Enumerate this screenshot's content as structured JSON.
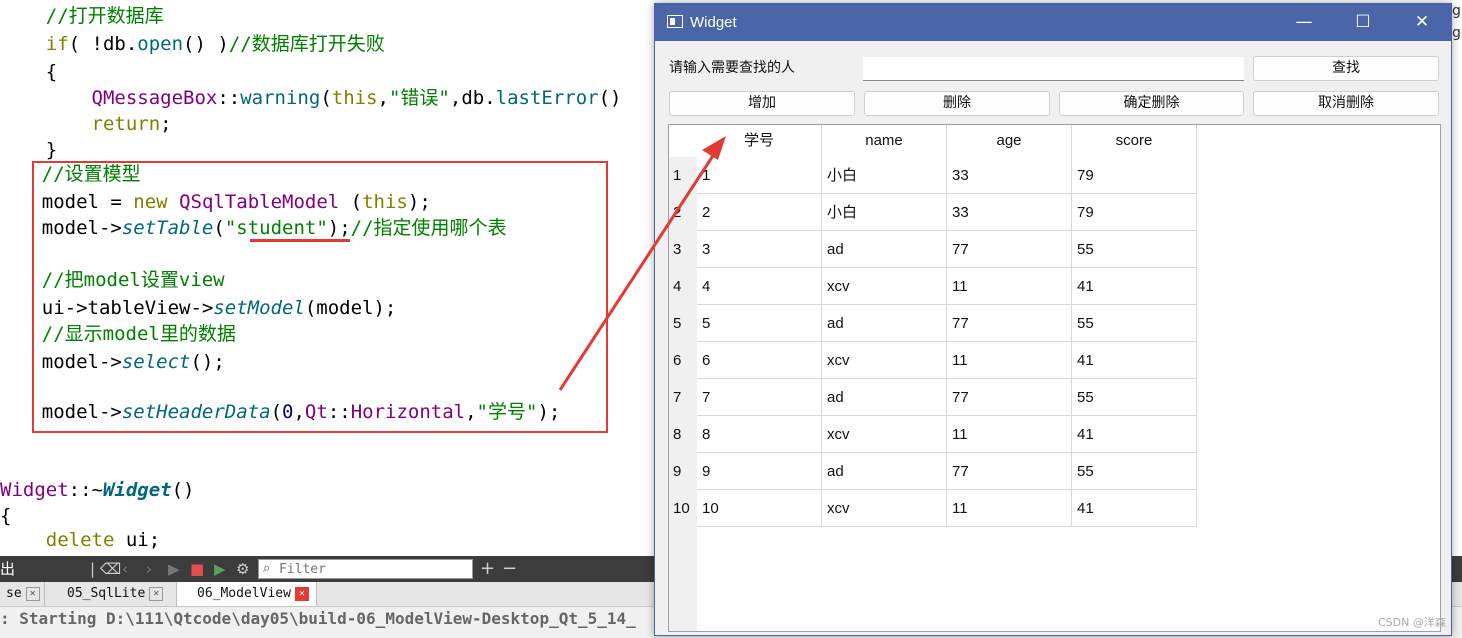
{
  "editor": {
    "lines": [
      [
        {
          "c": "t-cm",
          "t": "    //打开数据库"
        }
      ],
      [
        {
          "c": "t-kw",
          "t": "    if"
        },
        {
          "c": "t-pl",
          "t": "( !db."
        },
        {
          "c": "t-fn",
          "t": "open"
        },
        {
          "c": "t-pl",
          "t": "() )"
        },
        {
          "c": "t-cm",
          "t": "//数据库打开失败"
        }
      ],
      [
        {
          "c": "t-pl",
          "t": "    {"
        }
      ],
      [
        {
          "c": "t-cls",
          "t": "        QMessageBox"
        },
        {
          "c": "t-pl",
          "t": "::"
        },
        {
          "c": "t-fn",
          "t": "warning"
        },
        {
          "c": "t-pl",
          "t": "("
        },
        {
          "c": "t-kw",
          "t": "this"
        },
        {
          "c": "t-pl",
          "t": ","
        },
        {
          "c": "t-str",
          "t": "\"错误\""
        },
        {
          "c": "t-pl",
          "t": ",db."
        },
        {
          "c": "t-fn",
          "t": "lastError"
        },
        {
          "c": "t-pl",
          "t": "()"
        }
      ],
      [
        {
          "c": "t-kw",
          "t": "        return"
        },
        {
          "c": "t-pl",
          "t": ";"
        }
      ],
      [
        {
          "c": "t-pl",
          "t": "    }"
        }
      ],
      [
        {
          "c": "t-cm",
          "t": "    //设置模型"
        }
      ],
      [
        {
          "c": "t-pl",
          "t": "    model = "
        },
        {
          "c": "t-kw",
          "t": "new"
        },
        {
          "c": "t-pl",
          "t": " "
        },
        {
          "c": "t-cls",
          "t": "QSqlTableModel"
        },
        {
          "c": "t-pl",
          "t": " ("
        },
        {
          "c": "t-kw",
          "t": "this"
        },
        {
          "c": "t-pl",
          "t": ");"
        }
      ],
      [
        {
          "c": "t-pl",
          "t": "    model->"
        },
        {
          "c": "t-it",
          "t": "setTable"
        },
        {
          "c": "t-pl",
          "t": "("
        },
        {
          "c": "t-str",
          "t": "\"student\""
        },
        {
          "c": "t-pl",
          "t": ");"
        },
        {
          "c": "t-cm",
          "t": "//指定使用哪个表"
        }
      ],
      [
        {
          "c": "t-pl",
          "t": ""
        }
      ],
      [
        {
          "c": "t-cm",
          "t": "    //把model设置view"
        }
      ],
      [
        {
          "c": "t-pl",
          "t": "    ui->tableView->"
        },
        {
          "c": "t-it",
          "t": "setModel"
        },
        {
          "c": "t-pl",
          "t": "(model);"
        }
      ],
      [
        {
          "c": "t-cm",
          "t": "    //显示model里的数据"
        }
      ],
      [
        {
          "c": "t-pl",
          "t": "    model->"
        },
        {
          "c": "t-it",
          "t": "select"
        },
        {
          "c": "t-pl",
          "t": "();"
        }
      ],
      [
        {
          "c": "t-pl",
          "t": ""
        }
      ],
      [
        {
          "c": "t-pl",
          "t": "    model->"
        },
        {
          "c": "t-it",
          "t": "setHeaderData"
        },
        {
          "c": "t-pl",
          "t": "("
        },
        {
          "c": "t-num",
          "t": "0"
        },
        {
          "c": "t-pl",
          "t": ","
        },
        {
          "c": "t-cls",
          "t": "Qt"
        },
        {
          "c": "t-pl",
          "t": "::"
        },
        {
          "c": "t-cls",
          "t": "Horizontal"
        },
        {
          "c": "t-pl",
          "t": ","
        },
        {
          "c": "t-str",
          "t": "\"学号\""
        },
        {
          "c": "t-pl",
          "t": ");"
        }
      ],
      [
        {
          "c": "t-pl",
          "t": "}"
        }
      ],
      [
        {
          "c": "t-pl",
          "t": ""
        }
      ],
      [
        {
          "c": "t-cls",
          "t": "Widget"
        },
        {
          "c": "t-pl",
          "t": "::~"
        },
        {
          "c": "t-bi",
          "t": "Widget"
        },
        {
          "c": "t-pl",
          "t": "()"
        }
      ],
      [
        {
          "c": "t-pl",
          "t": "{"
        }
      ],
      [
        {
          "c": "t-kw",
          "t": "    delete"
        },
        {
          "c": "t-pl",
          "t": " ui;"
        }
      ]
    ],
    "right_edge_glyphs": "g\ng"
  },
  "bottom_panel": {
    "left_label": "出",
    "filter_placeholder": "Filter",
    "tabs": [
      {
        "label": "se",
        "active": false,
        "close_red": false
      },
      {
        "label": "05_SqlLite",
        "active": false,
        "close_red": false
      },
      {
        "label": "06_ModelView",
        "active": true,
        "close_red": true
      }
    ],
    "output_text": ": Starting D:\\111\\Qtcode\\day05\\build-06_ModelView-Desktop_Qt_5_14_"
  },
  "widget": {
    "title": "Widget",
    "minimize": "—",
    "maximize": "☐",
    "close": "✕",
    "search_label": "请输入需要查找的人",
    "search_value": "",
    "find_button": "查找",
    "add_button": "增加",
    "delete_button": "删除",
    "confirm_delete_button": "确定删除",
    "cancel_delete_button": "取消删除",
    "table": {
      "headers": [
        "学号",
        "name",
        "age",
        "score"
      ],
      "row_numbers": [
        "1",
        "2",
        "3",
        "4",
        "5",
        "6",
        "7",
        "8",
        "9",
        "10"
      ],
      "rows": [
        [
          "1",
          "小白",
          "33",
          "79"
        ],
        [
          "2",
          "小白",
          "33",
          "79"
        ],
        [
          "3",
          "ad",
          "77",
          "55"
        ],
        [
          "4",
          "xcv",
          "11",
          "41"
        ],
        [
          "5",
          "ad",
          "77",
          "55"
        ],
        [
          "6",
          "xcv",
          "11",
          "41"
        ],
        [
          "7",
          "ad",
          "77",
          "55"
        ],
        [
          "8",
          "xcv",
          "11",
          "41"
        ],
        [
          "9",
          "ad",
          "77",
          "55"
        ],
        [
          "10",
          "xcv",
          "11",
          "41"
        ]
      ]
    }
  },
  "watermark": "CSDN @洋森",
  "colors": {
    "annotation_red": "#e53935",
    "titlebar": "#4a66a8"
  }
}
